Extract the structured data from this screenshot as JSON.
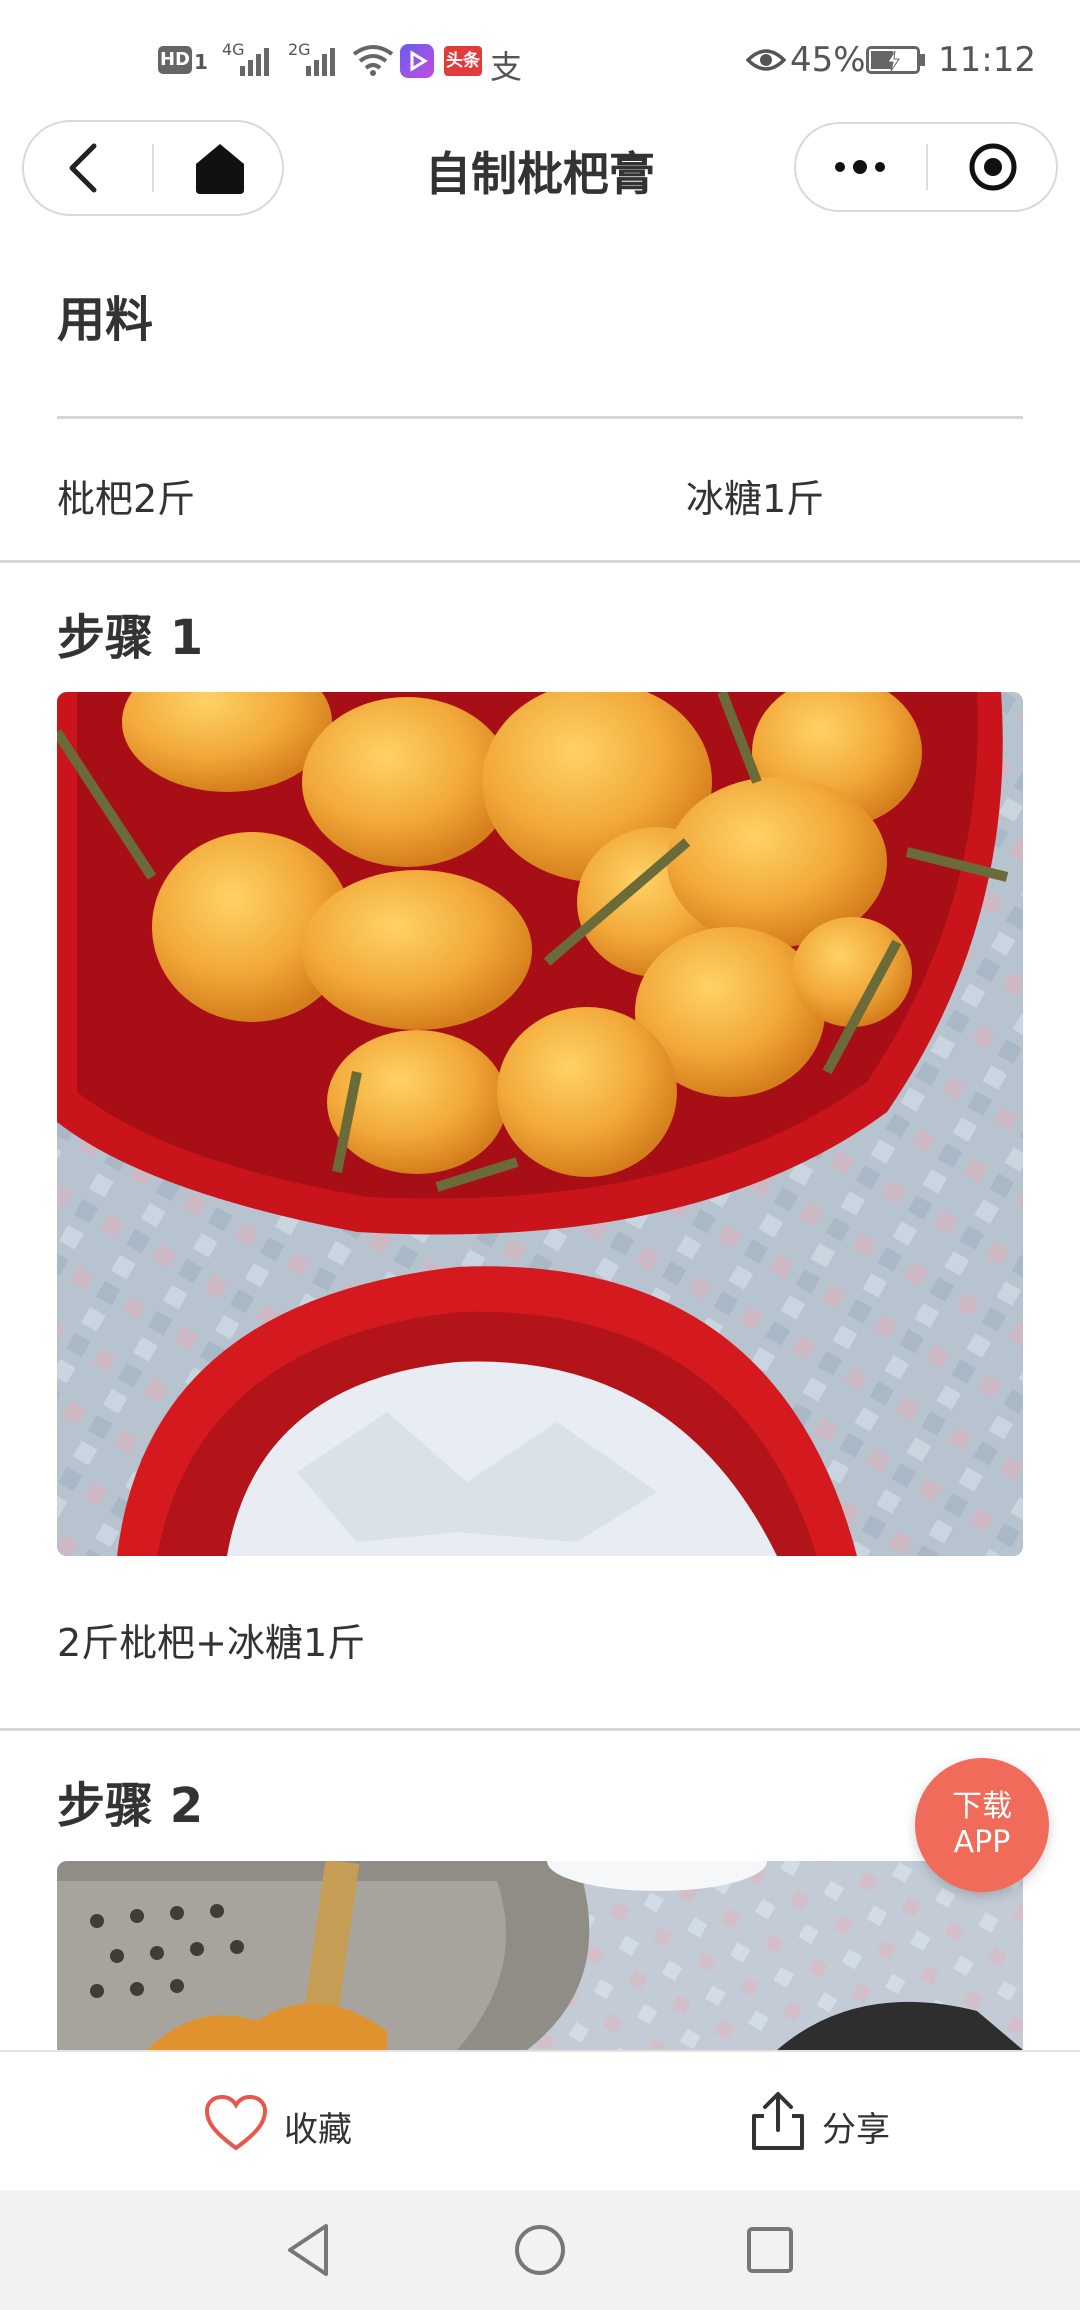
{
  "status_bar": {
    "left_icons": [
      "hd-icon",
      "4g-signal-icon",
      "2g-signal-icon",
      "wifi-icon",
      "video-app-icon",
      "toutiao-app-icon",
      "alipay-icon"
    ],
    "hd_label": "HD",
    "sim1": "1",
    "net1": "4G",
    "net2": "2G",
    "toutiao": "头条",
    "alipay": "支",
    "battery": "45%",
    "time": "11:12"
  },
  "title_bar": {
    "title": "自制枇杷膏",
    "icons": [
      "back-icon",
      "home-icon",
      "more-icon",
      "close-miniprogram-icon"
    ]
  },
  "ingredients": {
    "heading": "用料",
    "items": [
      {
        "name": "枇杷2斤"
      },
      {
        "name": "冰糖1斤"
      }
    ]
  },
  "steps": [
    {
      "title": "步骤 1",
      "description": "2斤枇杷+冰糖1斤"
    },
    {
      "title": "步骤 2"
    }
  ],
  "fab": {
    "line1": "下载",
    "line2": "APP"
  },
  "bottom_bar": {
    "favorite_label": "收藏",
    "share_label": "分享"
  },
  "colors": {
    "accent": "#f06b5a",
    "favorite_heart": "#e8574c"
  }
}
